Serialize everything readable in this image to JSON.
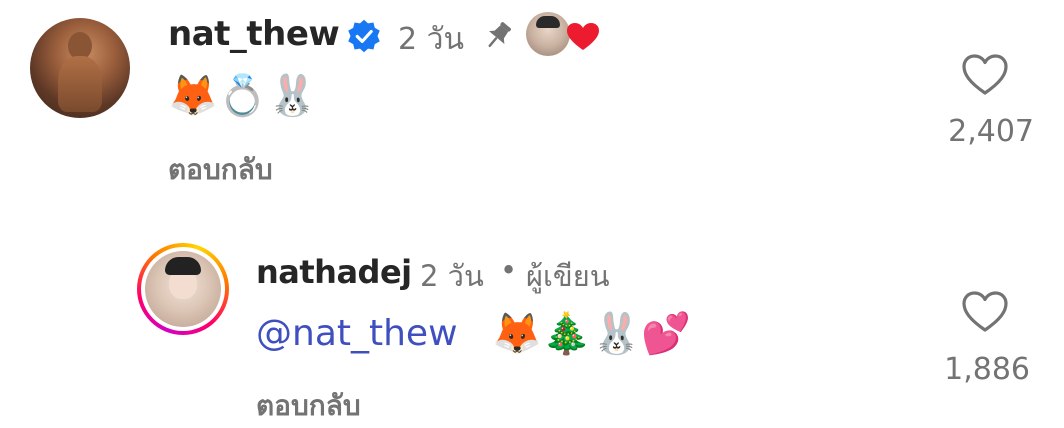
{
  "comments": [
    {
      "username": "nat_thew",
      "verified": true,
      "time": "2 วัน",
      "pinned": true,
      "liked_by_author": true,
      "text_emoji": "🦊💍🐰",
      "reply_label": "ตอบกลับ",
      "like_count": "2,407"
    },
    {
      "username": "nathadej",
      "time": "2 วัน",
      "separator": "•",
      "author_badge": "ผู้เขียน",
      "mention": "@nat_thew",
      "text_emoji": "🦊🎄🐰💕",
      "reply_label": "ตอบกลับ",
      "like_count": "1,886"
    }
  ],
  "colors": {
    "username": "#262626",
    "meta": "#737373",
    "mention": "#3f4fc0",
    "verified": "#1877f2",
    "heart_red": "#ed1b2f"
  }
}
